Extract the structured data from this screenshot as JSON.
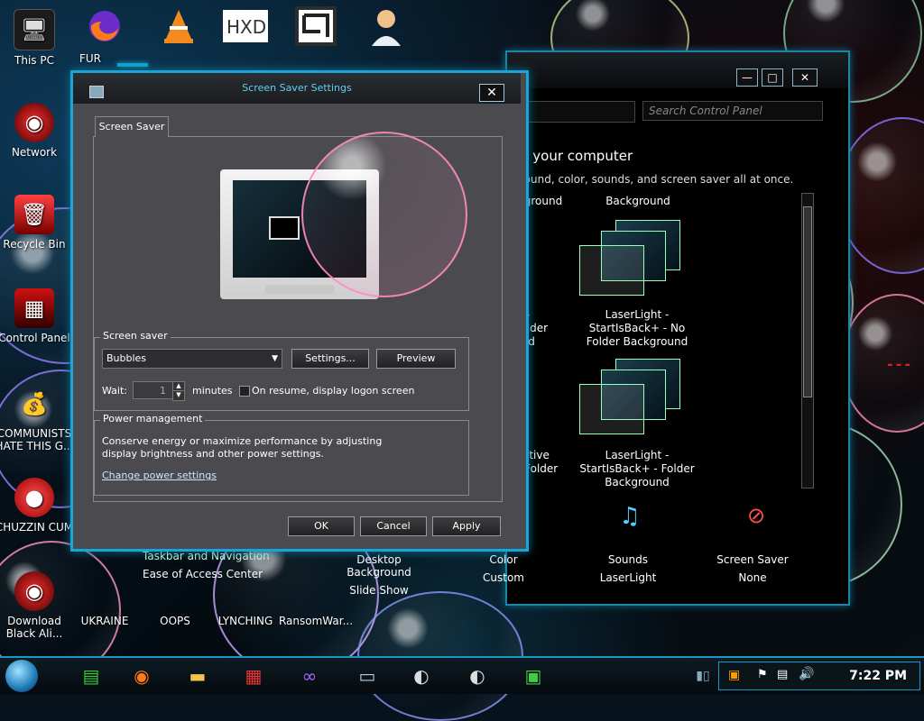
{
  "desktop": {
    "left_icons": [
      {
        "label": "This PC",
        "icon": "computer-icon"
      },
      {
        "label": "Network",
        "icon": "network-icon"
      },
      {
        "label": "Recycle Bin",
        "icon": "recycle-bin-icon"
      },
      {
        "label": "Control Panel",
        "icon": "control-panel-icon"
      },
      {
        "label": "COMMUNISTS HATE THIS G...",
        "icon": "money-bag-icon"
      },
      {
        "label": "CHUZZIN CUM",
        "icon": "chuzzle-icon"
      },
      {
        "label": "Download Black Ali...",
        "icon": "alienware-icon"
      }
    ],
    "top_icons": [
      {
        "label": "FUR",
        "icon": "firefox-icon"
      },
      {
        "label": "",
        "icon": "vlc-icon"
      },
      {
        "label": "",
        "icon": "hxd-icon"
      },
      {
        "label": "",
        "icon": "maze-icon"
      },
      {
        "label": "",
        "icon": "doctor-icon"
      }
    ],
    "bottom_icons": [
      {
        "label": "UKRAINE"
      },
      {
        "label": "OOPS"
      },
      {
        "label": "LYNCHING"
      },
      {
        "label": "RansomWar..."
      }
    ]
  },
  "control_panel": {
    "search_placeholder": "Search Control Panel",
    "heading": "n your computer",
    "subheading": "round, color, sounds, and screen saver all at once.",
    "themes": [
      {
        "label": "ground"
      },
      {
        "label": "Background"
      },
      {
        "label": "D -\nFolder\nund"
      },
      {
        "label": "LaserLight -\nStartIsBack+ - No\nFolder Background"
      },
      {
        "label": "Native\no Folder"
      },
      {
        "label": "LaserLight -\nStartIsBack+ - Folder\nBackground"
      }
    ],
    "bottom_bar": [
      {
        "title": "Desktop Background",
        "value": "Slide Show"
      },
      {
        "title": "Color",
        "value": "Custom"
      },
      {
        "title": "Sounds",
        "value": "LaserLight"
      },
      {
        "title": "Screen Saver",
        "value": "None"
      }
    ],
    "left_links": [
      "Taskbar and Navigation",
      "Ease of Access Center"
    ],
    "buttons": {
      "minimize": "—",
      "maximize": "□",
      "close": "✕"
    }
  },
  "dialog": {
    "title": "Screen Saver Settings",
    "close": "✕",
    "tab": "Screen Saver",
    "screensaver_group": "Screen saver",
    "selected_screensaver": "Bubbles",
    "settings_button": "Settings...",
    "preview_button": "Preview",
    "wait_label": "Wait:",
    "wait_value": "1",
    "minutes_label": "minutes",
    "resume_label": "On resume, display logon screen",
    "power_group": "Power management",
    "power_text": "Conserve energy or maximize performance by adjusting display brightness and other power settings.",
    "power_link": "Change power settings",
    "ok": "OK",
    "cancel": "Cancel",
    "apply": "Apply"
  },
  "taskbar": {
    "clock": "7:22 PM",
    "pinned": [
      "notes-icon",
      "firefox-icon",
      "file-explorer-icon",
      "alienware-icon",
      "mask-icon",
      "monitor-icon",
      "alien-head-icon",
      "alien-head-icon",
      "control-panel-icon"
    ]
  }
}
